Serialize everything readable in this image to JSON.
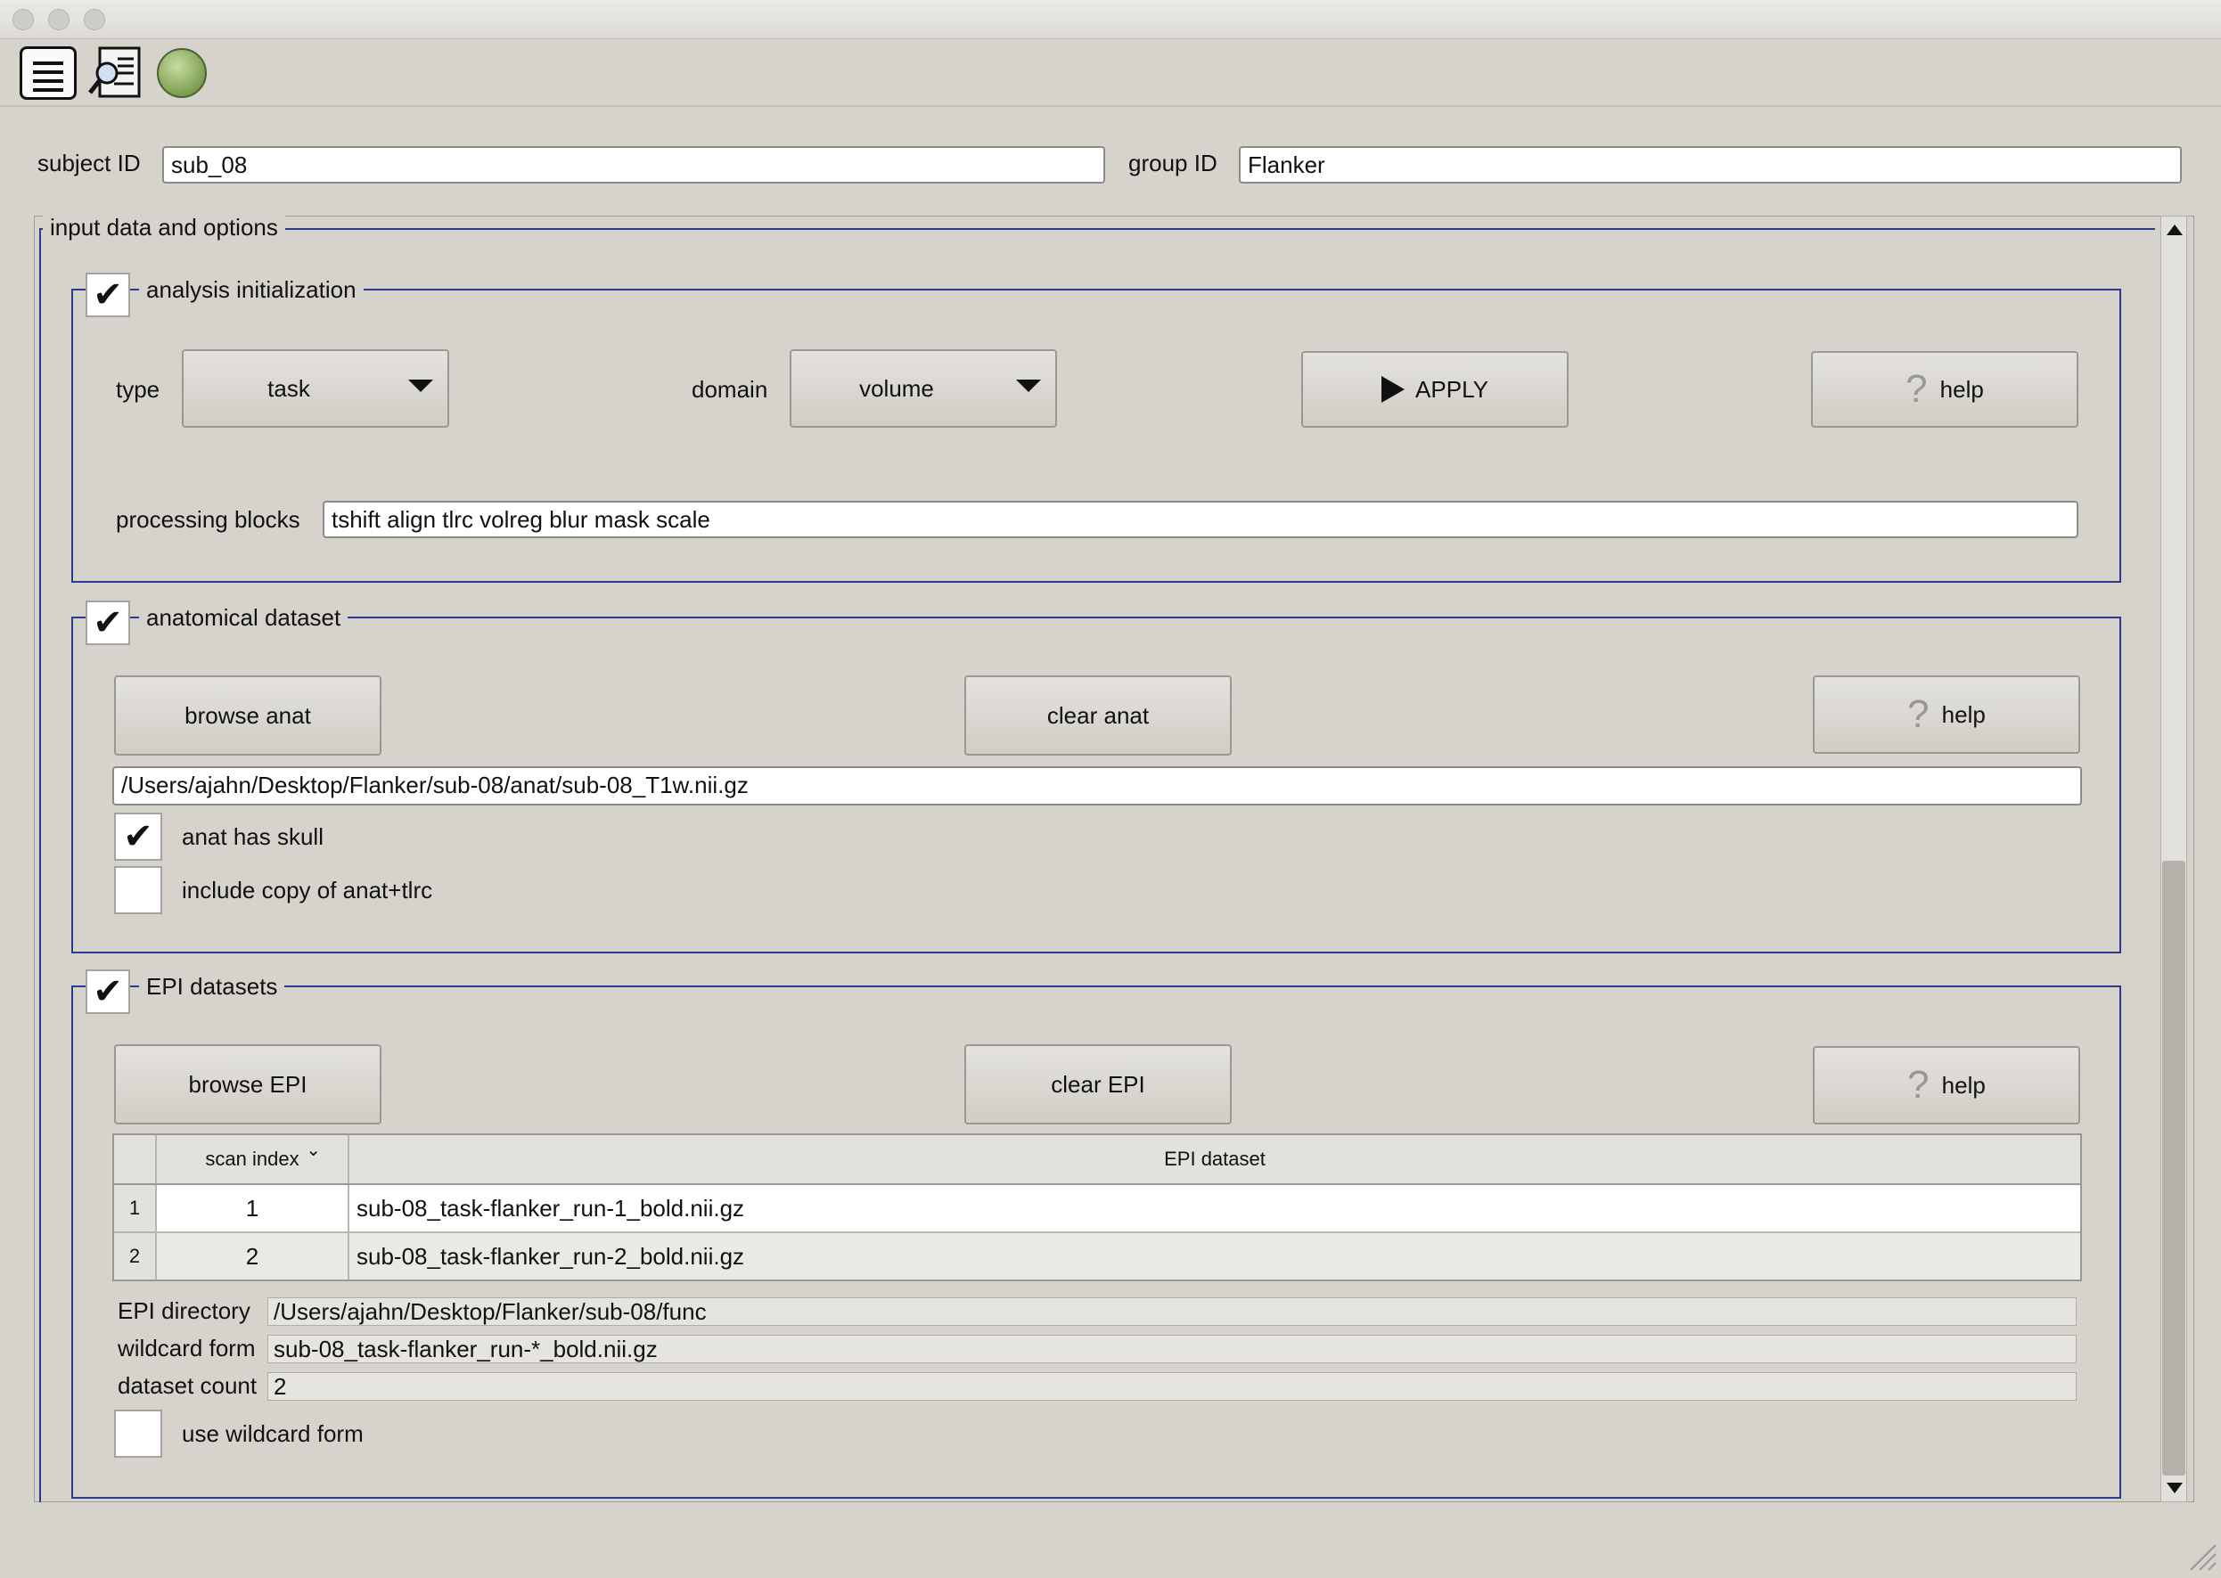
{
  "window": {
    "traffic_lights": [
      "close",
      "minimize",
      "zoom"
    ]
  },
  "toolbar": {
    "icons": [
      "document-list-icon",
      "inspect-icon",
      "green-circle-icon"
    ]
  },
  "subject": {
    "label": "subject ID",
    "value": "sub_08"
  },
  "group": {
    "label": "group ID",
    "value": "Flanker"
  },
  "main_section": {
    "title": "input data and options"
  },
  "analysis_init": {
    "title": "analysis initialization",
    "checked": true,
    "type_label": "type",
    "type_value": "task",
    "domain_label": "domain",
    "domain_value": "volume",
    "apply_label": "APPLY",
    "help_label": "help",
    "blocks_label": "processing blocks",
    "blocks_value": "tshift align tlrc volreg blur mask scale"
  },
  "anat": {
    "title": "anatomical dataset",
    "checked": true,
    "browse_label": "browse anat",
    "clear_label": "clear anat",
    "help_label": "help",
    "path": "/Users/ajahn/Desktop/Flanker/sub-08/anat/sub-08_T1w.nii.gz",
    "has_skull_label": "anat has skull",
    "has_skull_checked": true,
    "copy_label": "include copy of anat+tlrc",
    "copy_checked": false
  },
  "epi": {
    "title": "EPI datasets",
    "checked": true,
    "browse_label": "browse EPI",
    "clear_label": "clear EPI",
    "help_label": "help",
    "table": {
      "headers": [
        "scan index",
        "EPI dataset"
      ],
      "rows": [
        {
          "num": "1",
          "index": "1",
          "dataset": "sub-08_task-flanker_run-1_bold.nii.gz"
        },
        {
          "num": "2",
          "index": "2",
          "dataset": "sub-08_task-flanker_run-2_bold.nii.gz"
        }
      ]
    },
    "directory_label": "EPI directory",
    "directory_value": "/Users/ajahn/Desktop/Flanker/sub-08/func",
    "wildcard_label": "wildcard form",
    "wildcard_value": "sub-08_task-flanker_run-*_bold.nii.gz",
    "count_label": "dataset count",
    "count_value": "2",
    "use_wildcard_label": "use wildcard form",
    "use_wildcard_checked": false
  },
  "checkmark_glyph": "✔",
  "colors": {
    "background": "#d6d3cc",
    "group_border": "#2a3a8c",
    "button": "#dcd9d2"
  }
}
